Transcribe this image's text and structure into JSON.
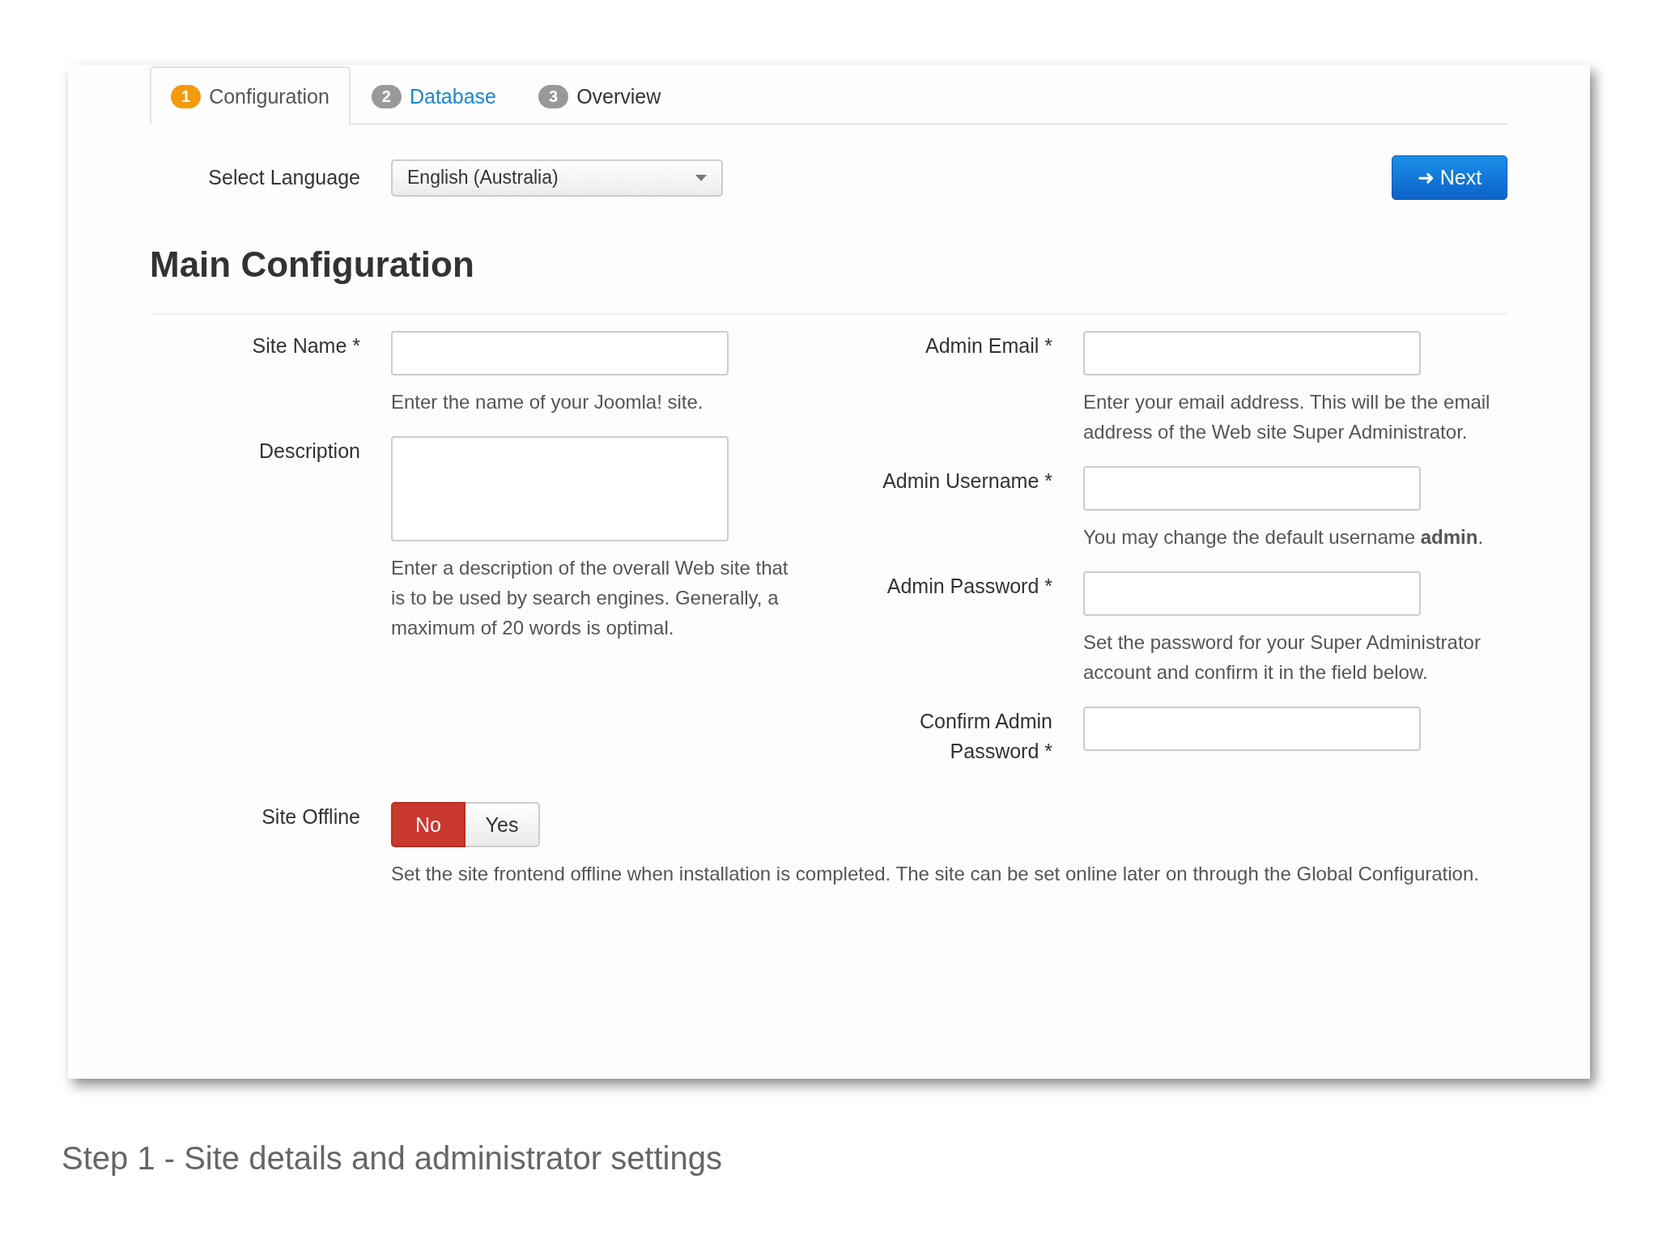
{
  "tabs": [
    {
      "number": "1",
      "label": "Configuration",
      "selected": true,
      "kind": "plain"
    },
    {
      "number": "2",
      "label": "Database",
      "selected": false,
      "kind": "link"
    },
    {
      "number": "3",
      "label": "Overview",
      "selected": false,
      "kind": "plain"
    }
  ],
  "language": {
    "label": "Select Language",
    "value": "English (Australia)"
  },
  "next_button": {
    "label": "Next",
    "icon": "➜"
  },
  "heading": "Main Configuration",
  "left_fields": [
    {
      "label": "Site Name *",
      "kind": "input",
      "help": "Enter the name of your Joomla! site."
    },
    {
      "label": "Description",
      "kind": "textarea",
      "help": "Enter a description of the overall Web site that is to be used by search engines. Generally, a maximum of 20 words is optimal."
    }
  ],
  "right_fields": [
    {
      "label": "Admin Email *",
      "kind": "input",
      "help": "Enter your email address. This will be the email address of the Web site Super Administrator."
    },
    {
      "label": "Admin Username *",
      "kind": "input",
      "help": "You may change the default username **admin**."
    },
    {
      "label": "Admin Password *",
      "kind": "input",
      "help": "Set the password for your Super Administrator account and confirm it in the field below."
    },
    {
      "label": "Confirm Admin Password *",
      "kind": "input"
    }
  ],
  "site_offline": {
    "label": "Site Offline",
    "options": [
      {
        "label": "No",
        "selected": true
      },
      {
        "label": "Yes",
        "selected": false
      }
    ],
    "help": "Set the site frontend offline when installation is completed. The site can be set online later on through the Global Configuration."
  },
  "caption": "Step 1 - Site details and administrator settings"
}
